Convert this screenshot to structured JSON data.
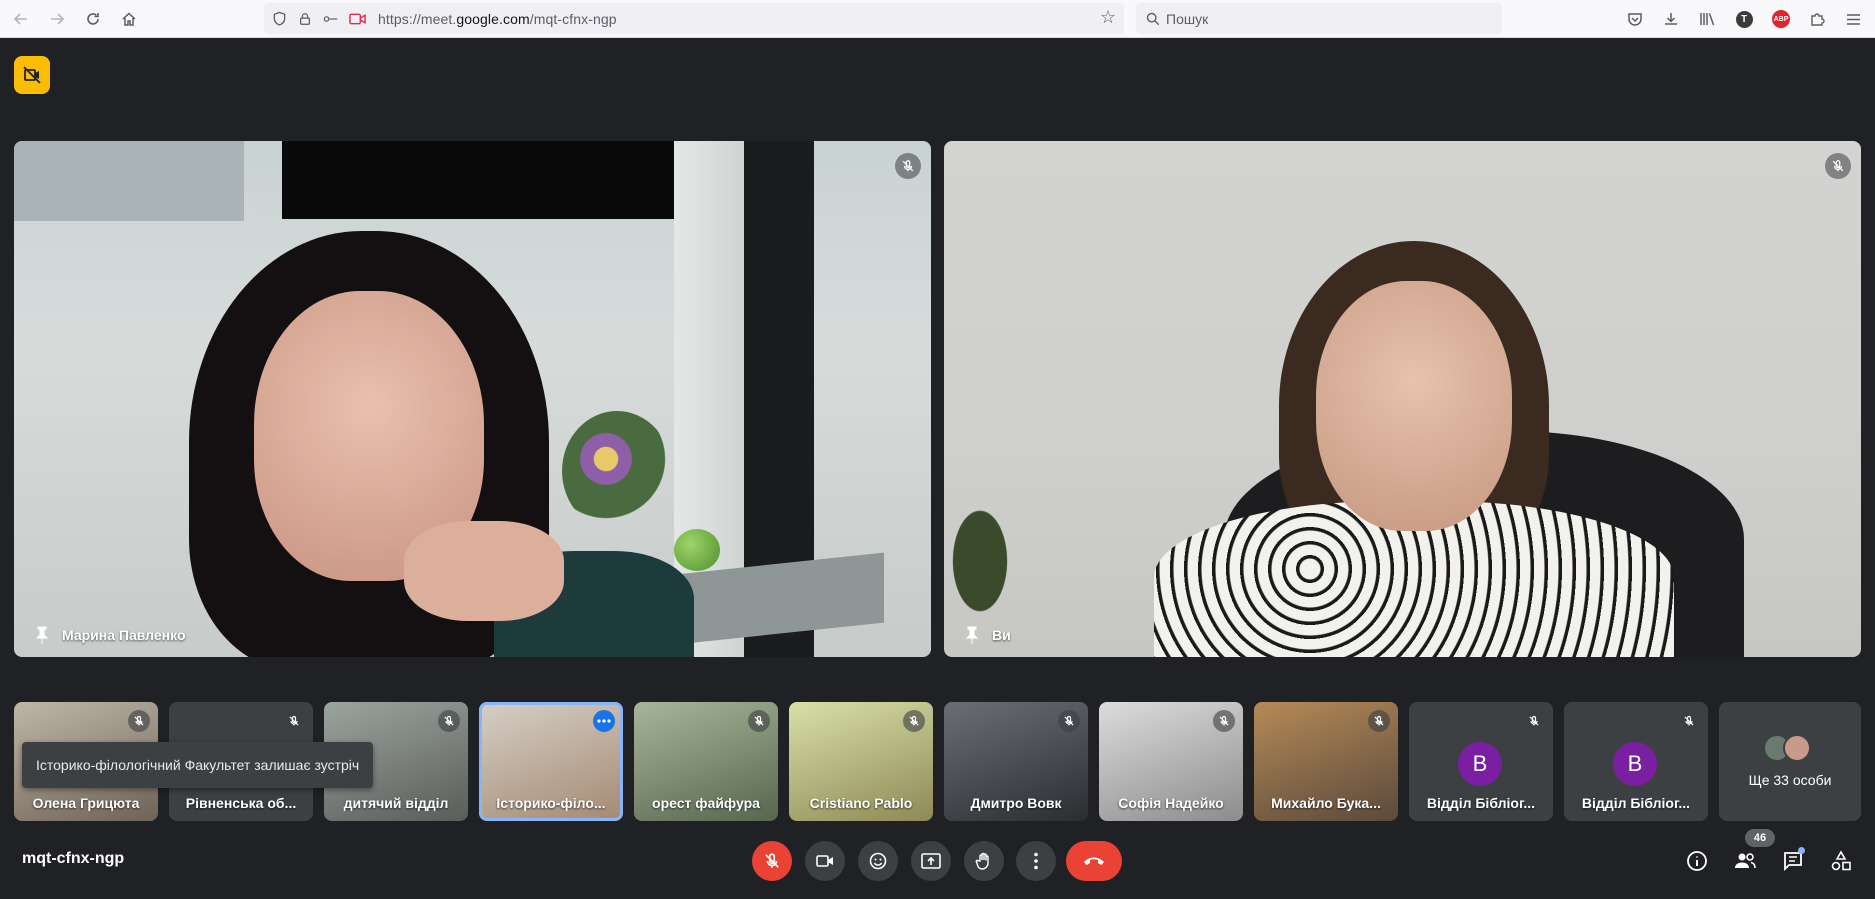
{
  "browser": {
    "url_prefix": "https://meet.",
    "url_domain": "google.com",
    "url_path": "/mqt-cfnx-ngp",
    "search_placeholder": "Пошук",
    "profile_initial": "T",
    "adblock_label": "ABP"
  },
  "meeting": {
    "code": "mqt-cfnx-ngp",
    "participant_count": "46",
    "tooltip": "Історико-філологічний Факультет залишає зустріч"
  },
  "main_tiles": [
    {
      "name": "Марина Павленко"
    },
    {
      "name": "Ви"
    }
  ],
  "thumbnails": [
    {
      "name": "Олена Грицюта"
    },
    {
      "name": "Рівненська об..."
    },
    {
      "name": "дитячий відділ"
    },
    {
      "name": "Історико-філо..."
    },
    {
      "name": "орест файфура"
    },
    {
      "name": "Cristiano Pablo"
    },
    {
      "name": "Дмитро Вовк"
    },
    {
      "name": "Софія Надейко"
    },
    {
      "name": "Михайло Бука..."
    },
    {
      "name": "Відділ Бібліог...",
      "initial": "В"
    },
    {
      "name": "Відділ Бібліог...",
      "initial": "В"
    }
  ],
  "more": {
    "label": "Ще 33 особи"
  },
  "colors": {
    "background": "#202124",
    "tile": "#3c4043",
    "danger": "#ea4335",
    "accent": "#8ab4f8",
    "avatar": "#7b1fa2",
    "badge": "#fbbc04"
  }
}
